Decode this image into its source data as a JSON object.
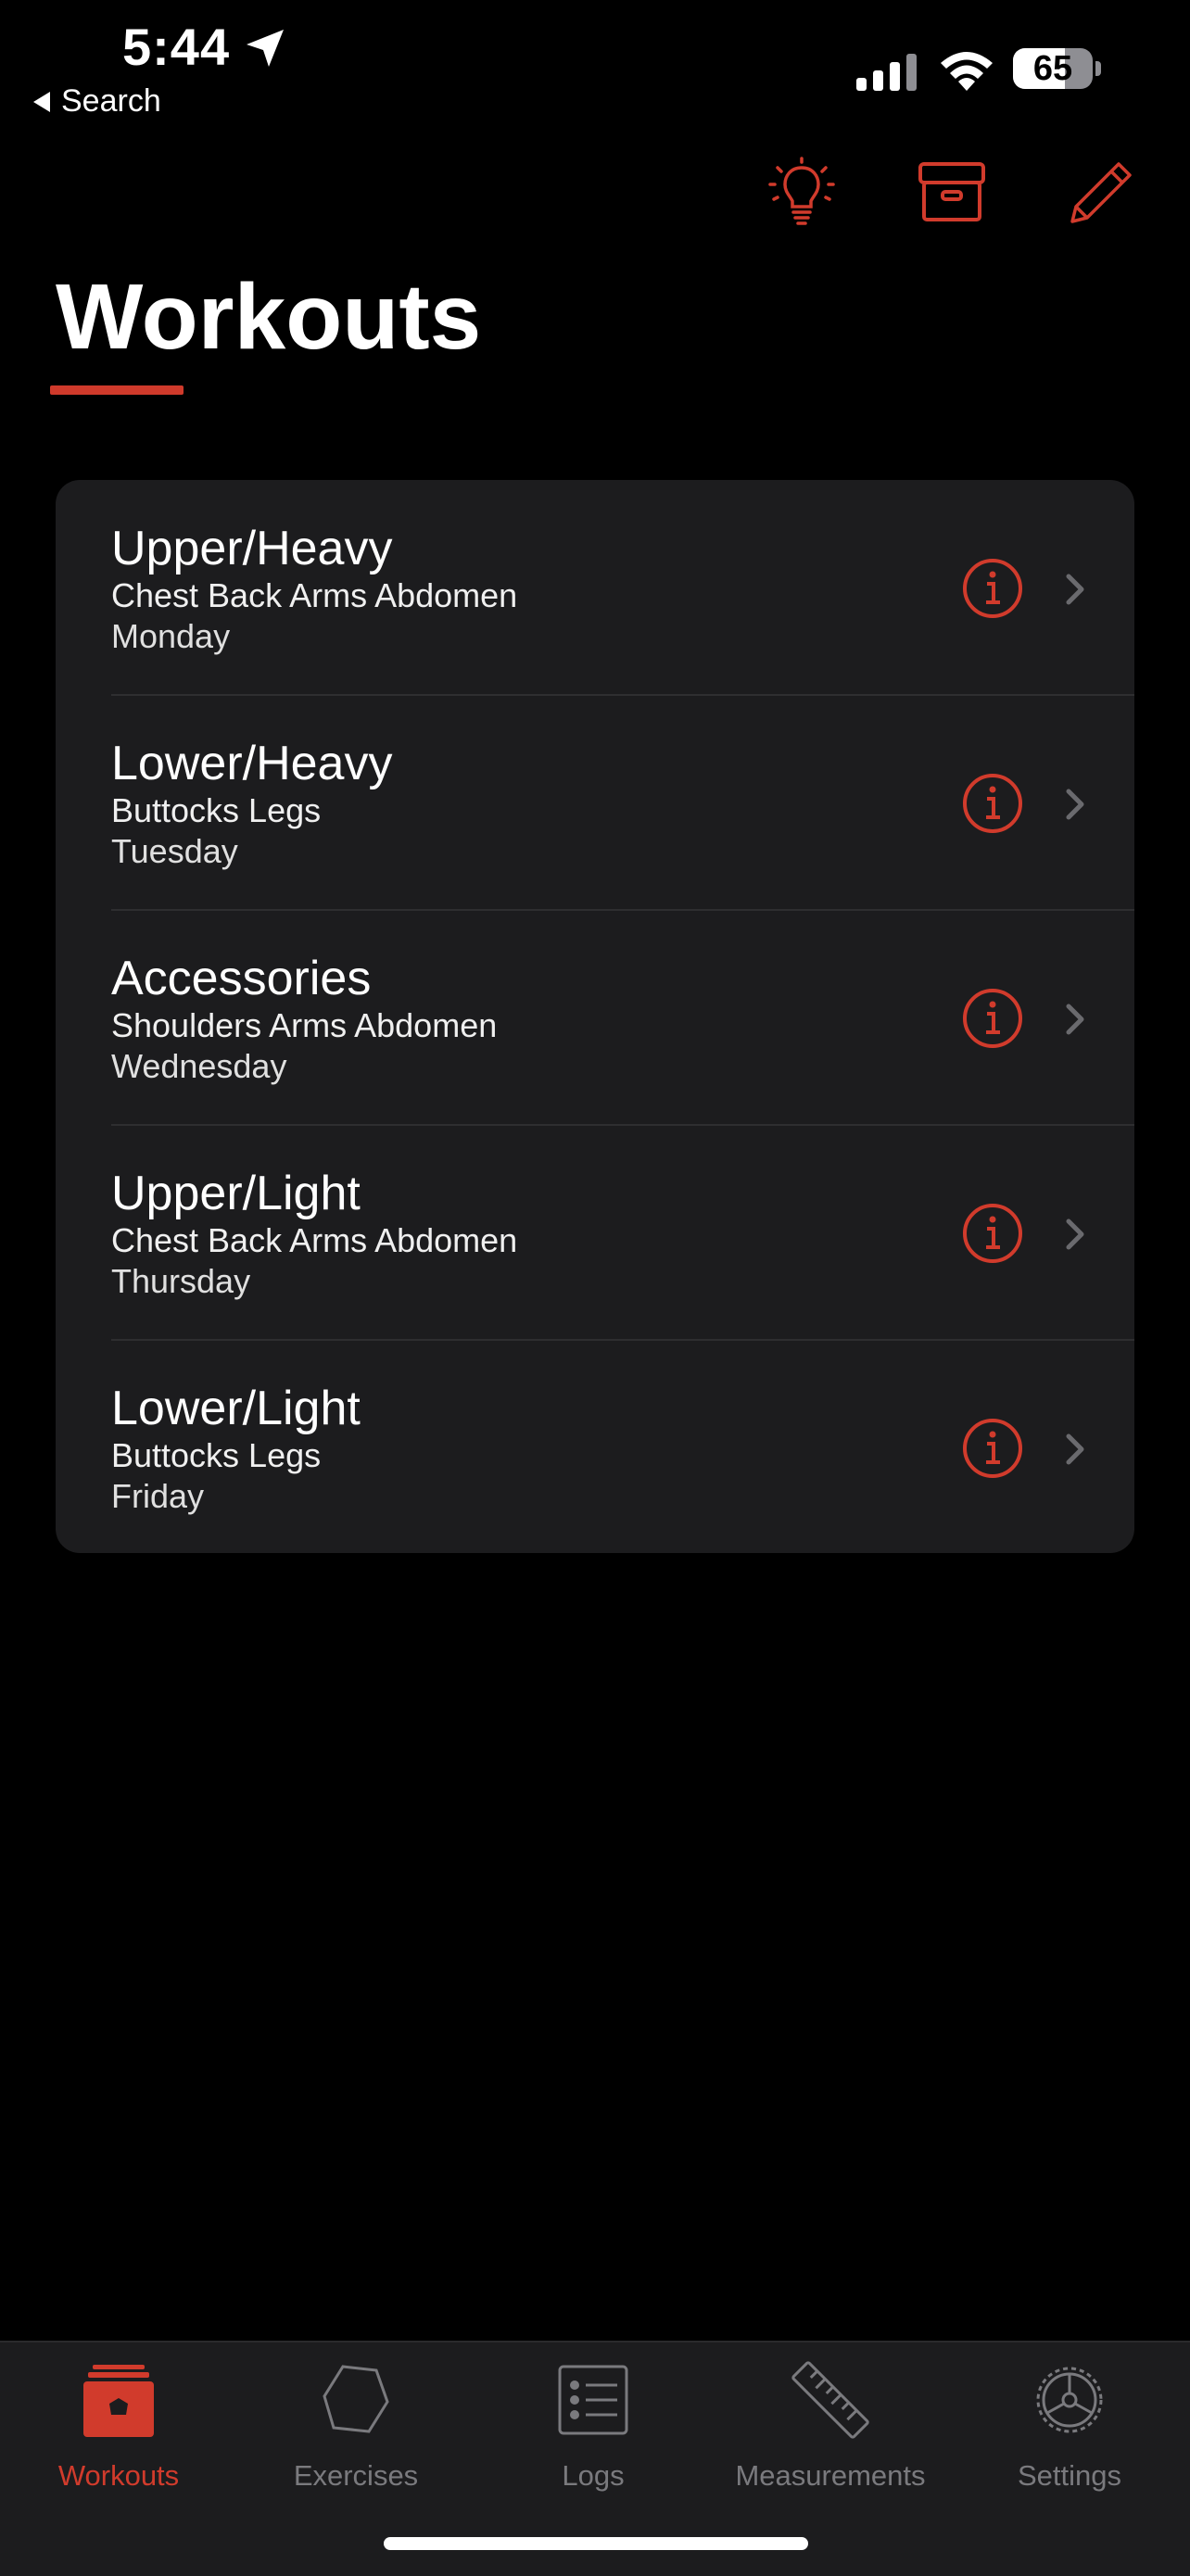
{
  "status_bar": {
    "time": "5:44",
    "back_label": "Search",
    "battery_percent": "65",
    "battery_level": 0.65
  },
  "header": {
    "title": "Workouts",
    "toolbar": [
      "lightbulb-icon",
      "archive-box-icon",
      "pencil-icon"
    ]
  },
  "workouts": [
    {
      "name": "Upper/Heavy",
      "muscles": "Chest Back Arms Abdomen",
      "day": "Monday"
    },
    {
      "name": "Lower/Heavy",
      "muscles": "Buttocks Legs",
      "day": "Tuesday"
    },
    {
      "name": "Accessories",
      "muscles": "Shoulders Arms Abdomen",
      "day": "Wednesday"
    },
    {
      "name": "Upper/Light",
      "muscles": "Chest Back Arms Abdomen",
      "day": "Thursday"
    },
    {
      "name": "Lower/Light",
      "muscles": "Buttocks Legs",
      "day": "Friday"
    }
  ],
  "tab_bar": {
    "tabs": [
      {
        "label": "Workouts",
        "icon": "workouts-icon",
        "active": true
      },
      {
        "label": "Exercises",
        "icon": "hexagon-icon",
        "active": false
      },
      {
        "label": "Logs",
        "icon": "list-icon",
        "active": false
      },
      {
        "label": "Measurements",
        "icon": "ruler-icon",
        "active": false
      },
      {
        "label": "Settings",
        "icon": "gear-icon",
        "active": false
      }
    ]
  },
  "colors": {
    "accent": "#d13b2c",
    "background": "#000000",
    "card": "#1c1c1e",
    "inactive_tab": "#7a7a7e"
  }
}
